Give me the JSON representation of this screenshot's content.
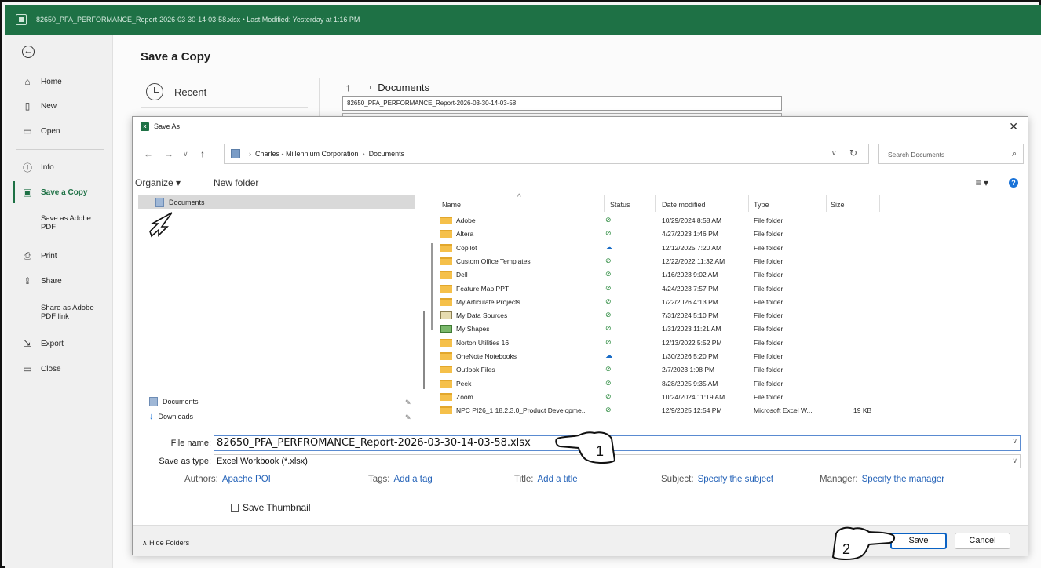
{
  "titlebar": {
    "title": "82650_PFA_PERFORMANCE_Report-2026-03-30-14-03-58.xlsx • Last Modified: Yesterday at 1:16 PM"
  },
  "nav": {
    "items": [
      {
        "label": "Home",
        "icon": "home-icon"
      },
      {
        "label": "New",
        "icon": "new-file-icon"
      },
      {
        "label": "Open",
        "icon": "folder-open-icon"
      },
      {
        "label": "Info",
        "icon": "info-icon"
      },
      {
        "label": "Save a Copy",
        "icon": "save-icon"
      },
      {
        "label": "Save as Adobe PDF"
      },
      {
        "label": "Print",
        "icon": "print-icon"
      },
      {
        "label": "Share",
        "icon": "share-icon"
      },
      {
        "label": "Share as Adobe PDF link"
      },
      {
        "label": "Export",
        "icon": "export-icon"
      },
      {
        "label": "Close",
        "icon": "close-doc-icon"
      }
    ]
  },
  "backstage": {
    "heading": "Save a Copy",
    "recent_label": "Recent",
    "location": "Documents",
    "filename": "82650_PFA_PERFORMANCE_Report-2026-03-30-14-03-58"
  },
  "dialog": {
    "title": "Save As",
    "breadcrumb": [
      "Charles - Millennium Corporation",
      "Documents"
    ],
    "search_placeholder": "Search Documents",
    "organize_label": "Organize ▾",
    "new_folder_label": "New folder",
    "tree": {
      "selected": "Documents",
      "quick_access": [
        "Documents",
        "Downloads"
      ]
    },
    "columns": [
      "Name",
      "Status",
      "Date modified",
      "Type",
      "Size"
    ],
    "files": [
      {
        "name": "Adobe",
        "status": "synced",
        "date": "10/29/2024 8:58 AM",
        "type": "File folder",
        "size": ""
      },
      {
        "name": "Altera",
        "status": "synced",
        "date": "4/27/2023 1:46 PM",
        "type": "File folder",
        "size": ""
      },
      {
        "name": "Copilot",
        "status": "cloud",
        "date": "12/12/2025 7:20 AM",
        "type": "File folder",
        "size": ""
      },
      {
        "name": "Custom Office Templates",
        "status": "synced",
        "date": "12/22/2022 11:32 AM",
        "type": "File folder",
        "size": ""
      },
      {
        "name": "Dell",
        "status": "synced",
        "date": "1/16/2023 9:02 AM",
        "type": "File folder",
        "size": ""
      },
      {
        "name": "Feature Map PPT",
        "status": "synced",
        "date": "4/24/2023 7:57 PM",
        "type": "File folder",
        "size": ""
      },
      {
        "name": "My Articulate Projects",
        "status": "synced",
        "date": "1/22/2026 4:13 PM",
        "type": "File folder",
        "size": ""
      },
      {
        "name": "My Data Sources",
        "status": "synced",
        "date": "7/31/2024 5:10 PM",
        "type": "File folder",
        "size": ""
      },
      {
        "name": "My Shapes",
        "status": "synced",
        "date": "1/31/2023 11:21 AM",
        "type": "File folder",
        "size": ""
      },
      {
        "name": "Norton Utilities 16",
        "status": "synced",
        "date": "12/13/2022 5:52 PM",
        "type": "File folder",
        "size": ""
      },
      {
        "name": "OneNote Notebooks",
        "status": "cloud",
        "date": "1/30/2026 5:20 PM",
        "type": "File folder",
        "size": ""
      },
      {
        "name": "Outlook Files",
        "status": "synced",
        "date": "2/7/2023 1:08 PM",
        "type": "File folder",
        "size": ""
      },
      {
        "name": "Peek",
        "status": "synced",
        "date": "8/28/2025 9:35 AM",
        "type": "File folder",
        "size": ""
      },
      {
        "name": "Zoom",
        "status": "synced",
        "date": "10/24/2024 11:19 AM",
        "type": "File folder",
        "size": ""
      },
      {
        "name": "NPC PI26_1 18.2.3.0_Product Developme...",
        "status": "synced",
        "date": "12/9/2025 12:54 PM",
        "type": "Microsoft Excel W...",
        "size": "19 KB"
      }
    ],
    "file_name_label": "File name:",
    "file_name_value": "82650_PFA_PERFROMANCE_Report-2026-03-30-14-03-58.xlsx",
    "save_type_label": "Save as type:",
    "save_type_value": "Excel Workbook (*.xlsx)",
    "authors_label": "Authors:",
    "authors_value": "Apache POI",
    "tags_label": "Tags:",
    "tags_value": "Add a tag",
    "title_label": "Title:",
    "title_value": "Add a title",
    "subject_label": "Subject:",
    "subject_value": "Specify the subject",
    "manager_label": "Manager:",
    "manager_value": "Specify the manager",
    "thumbnail_label": "Save Thumbnail",
    "hide_folders_label": "∧  Hide Folders",
    "save_label": "Save",
    "cancel_label": "Cancel"
  },
  "callouts": [
    "1",
    "2"
  ],
  "colors": {
    "excel_green": "#1e7145",
    "link_blue": "#2563b8",
    "save_border": "#0a62c4"
  }
}
